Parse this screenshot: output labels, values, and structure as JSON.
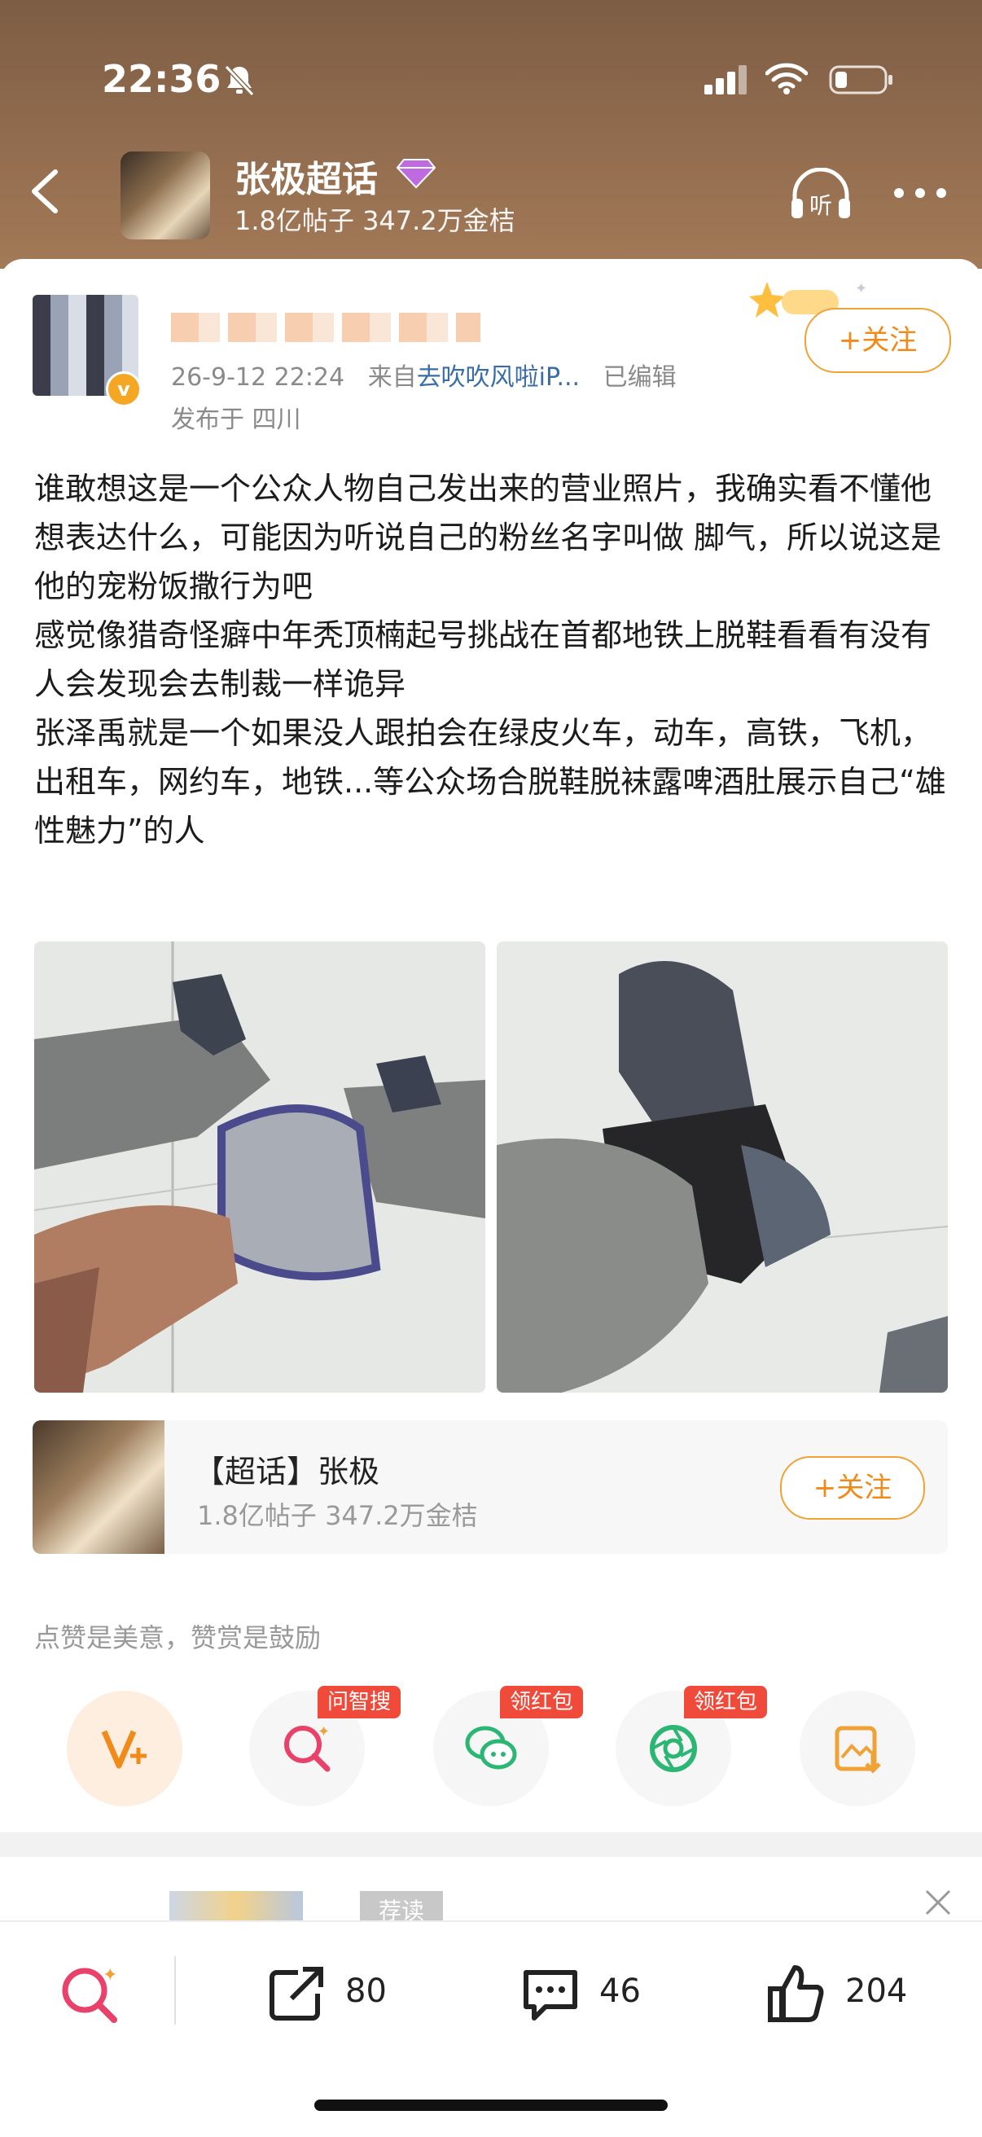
{
  "status_bar": {
    "time": "22:36"
  },
  "topic": {
    "title": "张极超话",
    "stats": "1.8亿帖子 347.2万金桔",
    "listen_label": "听"
  },
  "post": {
    "meta_time": "26-9-12 22:24",
    "meta_from": "来自",
    "meta_source": "去吹吹风啦iP...",
    "meta_edited": "已编辑",
    "location": "发布于 四川",
    "follow_label": "+关注",
    "text": "谁敢想这是一个公众人物自己发出来的营业照片，我确实看不懂他想表达什么，可能因为听说自己的粉丝名字叫做 脚气，所以说这是他的宠粉饭撒行为吧\n感觉像猎奇怪癖中年秃顶楠起号挑战在首都地铁上脱鞋看看有没有人会发现会去制裁一样诡异\n张泽禹就是一个如果没人跟拍会在绿皮火车，动车，高铁，飞机，出租车，网约车，地铁...等公众场合脱鞋脱袜露啤酒肚展示自己“雄性魅力”的人"
  },
  "topic_card": {
    "title": "【超话】张极",
    "stats": "1.8亿帖子 347.2万金桔",
    "follow_label": "+关注"
  },
  "reward_hint": "点赞是美意，赞赏是鼓励",
  "actions": {
    "tag_search": "问智搜",
    "tag_wechat": "领红包",
    "tag_moments": "领红包"
  },
  "recommend": {
    "tag": "荐读"
  },
  "bottom_bar": {
    "share_count": "80",
    "comment_count": "46",
    "like_count": "204"
  },
  "colors": {
    "accent": "#f08a18",
    "link": "#3a6da8",
    "red_tag": "#f04a3a"
  }
}
